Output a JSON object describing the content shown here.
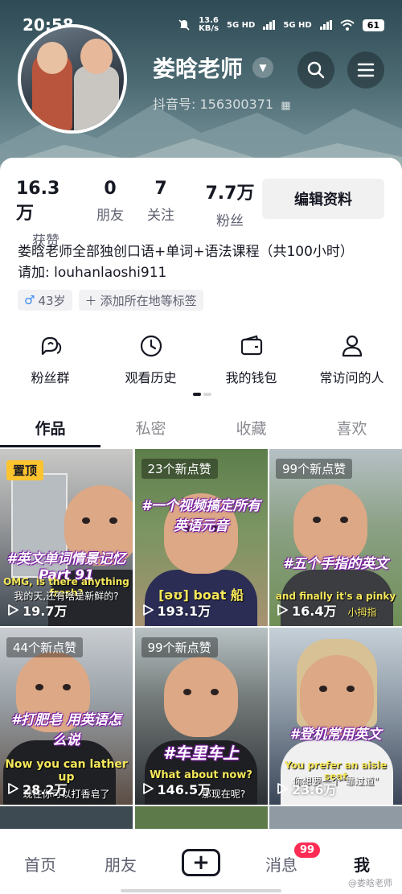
{
  "status": {
    "time": "20:58",
    "net_speed": "13.6",
    "net_unit": "KB/s",
    "sim1": "5G HD",
    "sim2": "5G HD",
    "battery": "61"
  },
  "profile": {
    "name": "娄晗老师",
    "douyin_id": "抖音号: 156300371",
    "bio_line1": "娄晗老师全部独创口语+单词+语法课程（共100小时）",
    "bio_line2": "请加: louhanlaoshi911",
    "gender_symbol": "♂",
    "age": "43岁",
    "add_tag": "添加所在地等标签"
  },
  "stats": [
    {
      "value": "16.3万",
      "label": "获赞"
    },
    {
      "value": "0",
      "label": "朋友"
    },
    {
      "value": "7",
      "label": "关注"
    },
    {
      "value": "7.7万",
      "label": "粉丝"
    }
  ],
  "edit_label": "编辑资料",
  "quick_actions": [
    {
      "label": "粉丝群",
      "icon": "fan-group-icon"
    },
    {
      "label": "观看历史",
      "icon": "history-clock-icon"
    },
    {
      "label": "我的钱包",
      "icon": "wallet-icon"
    },
    {
      "label": "常访问的人",
      "icon": "person-icon"
    }
  ],
  "tabs": [
    "作品",
    "私密",
    "收藏",
    "喜欢"
  ],
  "videos": [
    {
      "badge": "置顶",
      "caption": "#英文单词情景记忆 Part 91",
      "sub": "OMG, is there anything fresh?",
      "sub2": "我的天,还有啥是新鲜的?",
      "plays": "19.7万"
    },
    {
      "badge": "23个新点赞",
      "caption": "#一个视频搞定所有英语元音",
      "sub": "[əʊ] boat 船",
      "sub2": "",
      "plays": "193.1万"
    },
    {
      "badge": "99个新点赞",
      "caption": "#五个手指的英文",
      "sub": "and finally it's a pinky",
      "sub2": "小拇指",
      "plays": "16.4万"
    },
    {
      "badge": "44个新点赞",
      "caption": "#打肥皂 用英语怎么说",
      "sub": "Now you can lather up",
      "sub2": "现在你可以打香皂了",
      "plays": "28.2万"
    },
    {
      "badge": "99个新点赞",
      "caption": "#车里车上",
      "sub": "What about now?",
      "sub2": "那现在呢?",
      "plays": "146.5万"
    },
    {
      "badge": "",
      "caption": "#登机常用英文",
      "sub": "You prefer an aisle seat",
      "sub2": "你想要一个\"靠过道\"",
      "plays": "23.6万"
    }
  ],
  "bottom_nav": {
    "home": "首页",
    "friends": "朋友",
    "plus": "+",
    "messages": "消息",
    "messages_badge": "99",
    "me": "我"
  },
  "watermark": "@娄晗老师",
  "colors": {
    "accent_red": "#fe2c55",
    "pin_yellow": "#fdc42f",
    "text_main": "#161823"
  }
}
